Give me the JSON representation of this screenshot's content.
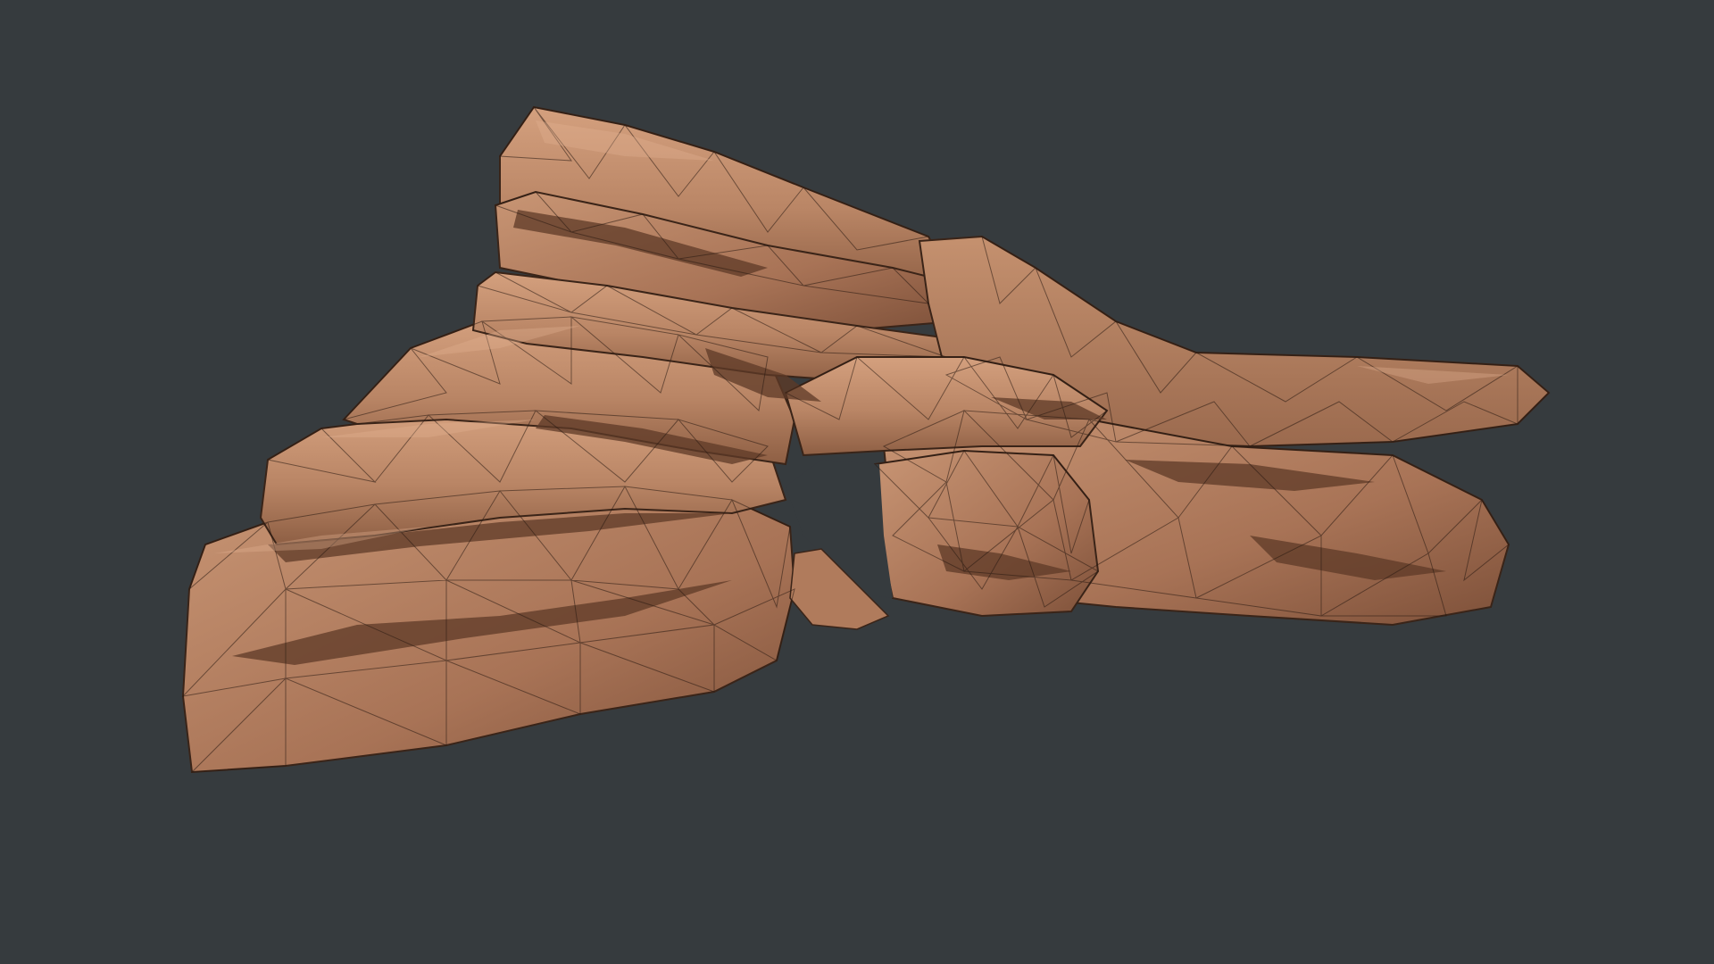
{
  "viewport": {
    "background_color": "#363b3e",
    "model": {
      "subject": "rock-formation",
      "display_mode": "shaded-with-wireframe",
      "base_color": "#b98565",
      "highlight_color": "#d9a483",
      "shadow_color": "#5e3a27",
      "wire_color": "#2a1a12"
    }
  }
}
